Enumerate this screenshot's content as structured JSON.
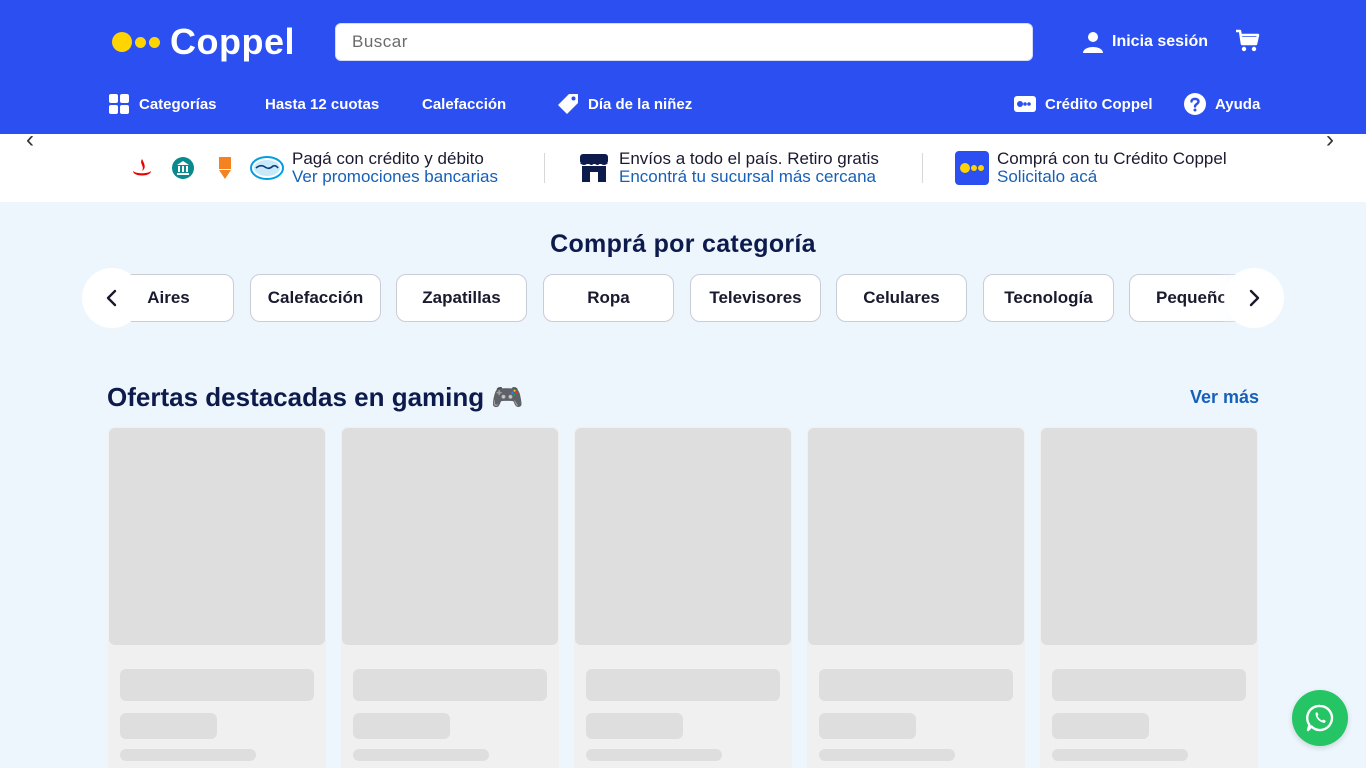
{
  "header": {
    "logo_text": "Coppel",
    "search_placeholder": "Buscar",
    "login_label": "Inicia sesión",
    "nav": [
      {
        "label": "Categorías",
        "icon": "grid-icon"
      },
      {
        "label": "Hasta 12 cuotas",
        "icon": ""
      },
      {
        "label": "Calefacción",
        "icon": ""
      },
      {
        "label": "Día de la niñez",
        "icon": "tag-icon"
      },
      {
        "label": "Crédito Coppel",
        "icon": "card-icon"
      },
      {
        "label": "Ayuda",
        "icon": "help-icon"
      }
    ]
  },
  "info_strip": [
    {
      "title": "Pagá con crédito y débito",
      "link": "Ver promociones bancarias"
    },
    {
      "title": "Envíos a todo el país. Retiro gratis",
      "link": "Encontrá tu sucursal más cercana"
    },
    {
      "title": "Comprá con tu Crédito Coppel",
      "link": "Solicitalo acá"
    }
  ],
  "categories": {
    "title": "Comprá por categoría",
    "items": [
      "Aires",
      "Calefacción",
      "Zapatillas",
      "Ropa",
      "Televisores",
      "Celulares",
      "Tecnología",
      "Pequeños"
    ]
  },
  "offers": {
    "title": "Ofertas destacadas en gaming 🎮",
    "more_label": "Ver más"
  },
  "colors": {
    "header_bg": "#2b4ff0",
    "brand_yellow": "#ffd400",
    "link_blue": "#1660b8",
    "whatsapp_green": "#25c464"
  }
}
